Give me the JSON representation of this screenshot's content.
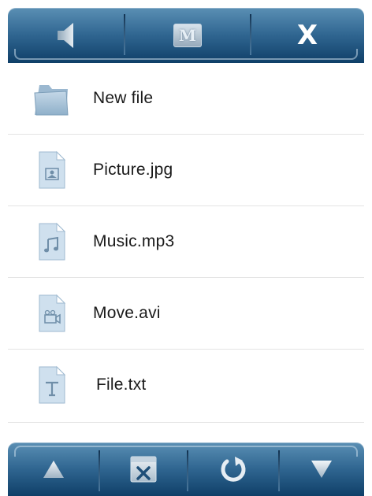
{
  "top_toolbar": {
    "buttons": [
      {
        "name": "speaker-icon"
      },
      {
        "name": "m-icon",
        "label": "M"
      },
      {
        "name": "close-icon",
        "label": "X"
      }
    ]
  },
  "files": [
    {
      "label": "New file",
      "icon": "folder-icon"
    },
    {
      "label": "Picture.jpg",
      "icon": "image-file-icon"
    },
    {
      "label": "Music.mp3",
      "icon": "music-file-icon"
    },
    {
      "label": "Move.avi",
      "icon": "video-file-icon"
    },
    {
      "label": "File.txt",
      "icon": "text-file-icon"
    }
  ],
  "bottom_toolbar": {
    "buttons": [
      {
        "name": "up-arrow-icon"
      },
      {
        "name": "delete-file-icon",
        "label": "x"
      },
      {
        "name": "refresh-icon"
      },
      {
        "name": "down-arrow-icon"
      }
    ]
  },
  "colors": {
    "toolbar_top": "#5a8fb4",
    "toolbar_bottom": "#0f3f68",
    "icon_fill": "#cfe0ee",
    "text": "#1a1a1a"
  }
}
